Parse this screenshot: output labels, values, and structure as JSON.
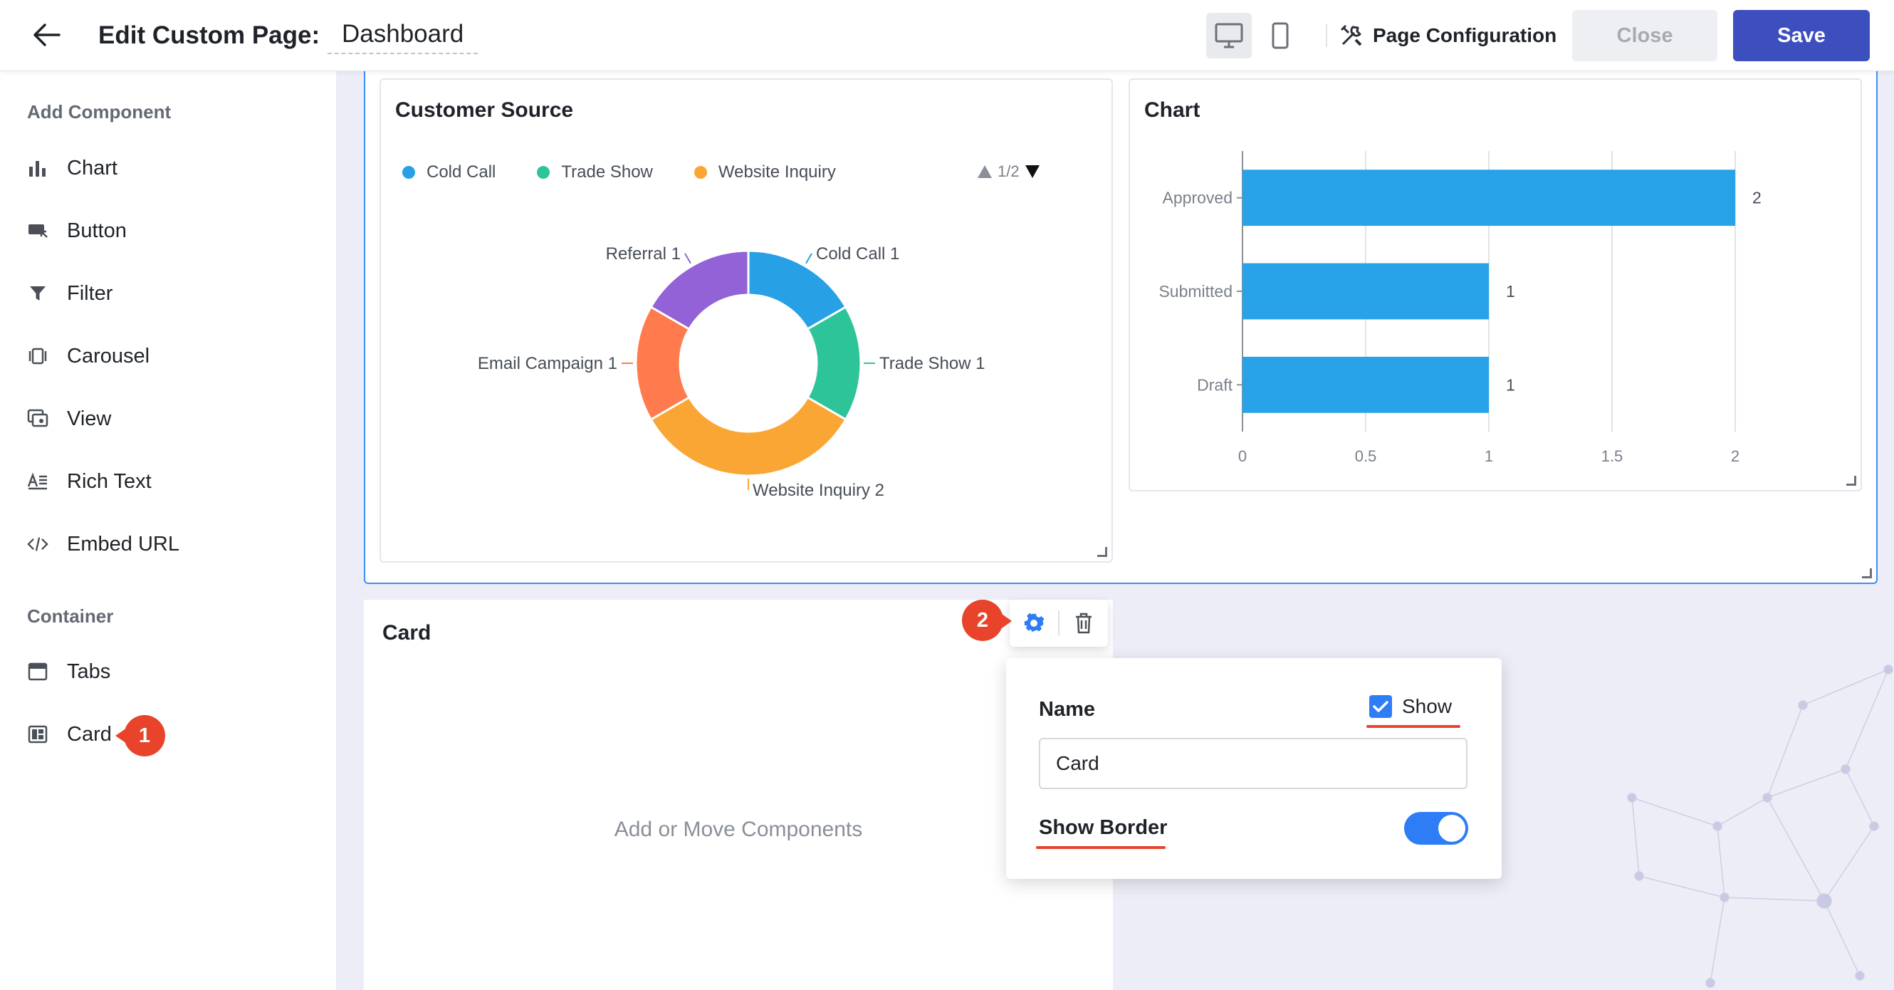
{
  "header": {
    "title_label": "Edit Custom Page:",
    "page_name": "Dashboard",
    "page_config_label": "Page Configuration",
    "close_label": "Close",
    "save_label": "Save"
  },
  "sidebar": {
    "add_component_title": "Add Component",
    "components": [
      {
        "label": "Chart",
        "icon": "bar-chart-icon"
      },
      {
        "label": "Button",
        "icon": "button-icon"
      },
      {
        "label": "Filter",
        "icon": "filter-icon"
      },
      {
        "label": "Carousel",
        "icon": "carousel-icon"
      },
      {
        "label": "View",
        "icon": "view-icon"
      },
      {
        "label": "Rich Text",
        "icon": "rich-text-icon"
      },
      {
        "label": "Embed URL",
        "icon": "code-icon"
      }
    ],
    "container_title": "Container",
    "containers": [
      {
        "label": "Tabs",
        "icon": "tabs-icon"
      },
      {
        "label": "Card",
        "icon": "card-icon"
      }
    ]
  },
  "badges": {
    "step1": "1",
    "step2": "2"
  },
  "customer_source": {
    "title": "Customer Source",
    "legend": [
      {
        "label": "Cold Call",
        "color": "#28a0e6"
      },
      {
        "label": "Trade Show",
        "color": "#2ec49a"
      },
      {
        "label": "Website Inquiry",
        "color": "#f9a634"
      }
    ],
    "pager": "1/2",
    "slice_labels": [
      {
        "name": "Referral",
        "value": "1"
      },
      {
        "name": "Cold Call",
        "value": "1"
      },
      {
        "name": "Email Campaign",
        "value": "1"
      },
      {
        "name": "Trade Show",
        "value": "1"
      },
      {
        "name": "Website Inquiry",
        "value": "2"
      }
    ]
  },
  "chart_data": [
    {
      "type": "pie",
      "title": "Customer Source",
      "categories": [
        "Cold Call",
        "Trade Show",
        "Website Inquiry",
        "Email Campaign",
        "Referral"
      ],
      "values": [
        1,
        1,
        2,
        1,
        1
      ],
      "colors": [
        "#28a0e6",
        "#2ec49a",
        "#f9a634",
        "#ff7a4d",
        "#9262d6"
      ],
      "donut": true
    },
    {
      "type": "bar",
      "orientation": "horizontal",
      "title": "Chart",
      "categories": [
        "Approved",
        "Submitted",
        "Draft"
      ],
      "values": [
        2,
        1,
        1
      ],
      "xlim": [
        0,
        2
      ],
      "ticks": [
        "0",
        "0.5",
        "1",
        "1.5",
        "2"
      ],
      "color": "#28a2e8",
      "grid": true
    }
  ],
  "card": {
    "title": "Card",
    "placeholder": "Add or Move Components"
  },
  "popover": {
    "name_label": "Name",
    "show_label": "Show",
    "show_checked": true,
    "name_value": "Card",
    "border_label": "Show Border",
    "border_on": true
  }
}
